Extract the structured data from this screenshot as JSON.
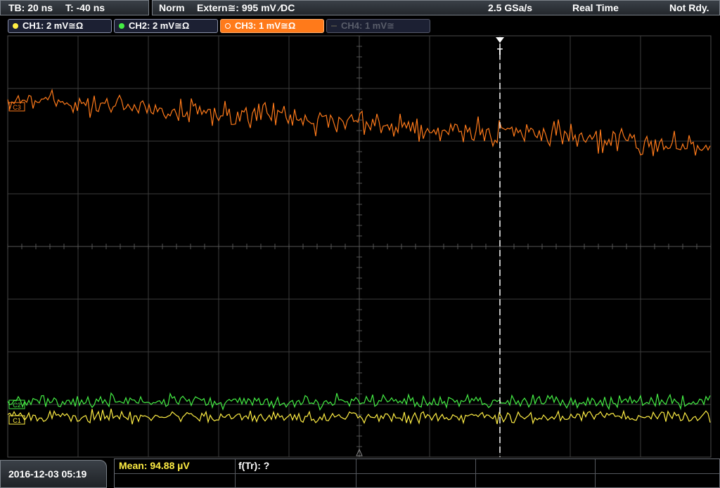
{
  "timebase": {
    "tb": "TB: 20 ns",
    "trigger_time": "T: -40 ns"
  },
  "status": {
    "trigger_mode": "Norm",
    "trigger_source": "Extern≅: 995 mV ⁄DC",
    "sample_rate": "2.5 GSa/s",
    "acq_mode": "Real Time",
    "trigger_state": "Not Rdy."
  },
  "channels": [
    {
      "label": "CH1: 2 mV≅Ω",
      "color": "#ffee44",
      "active": true
    },
    {
      "label": "CH2: 2 mV≅Ω",
      "color": "#44ee44",
      "active": true
    },
    {
      "label": "CH3: 1 mV≅Ω",
      "color": "#ff7a1a",
      "active": true,
      "selected": true
    },
    {
      "label": "CH4: 1 mV≅",
      "color": "#5a5e6a",
      "active": false
    }
  ],
  "markers": {
    "trigger_marker": "T",
    "ch3_ref": "C3",
    "ch2_ref": "C2",
    "ch1_ref": "C1"
  },
  "footer": {
    "datetime": "2016-12-03 05:19",
    "measurement_1": "Mean: 94.88 µV",
    "measurement_2": "f(Tr): ?"
  },
  "colors": {
    "ch1": "#ffee44",
    "ch2": "#44ee44",
    "ch3": "#ff7a1a",
    "grid": "#3c3c3c"
  }
}
